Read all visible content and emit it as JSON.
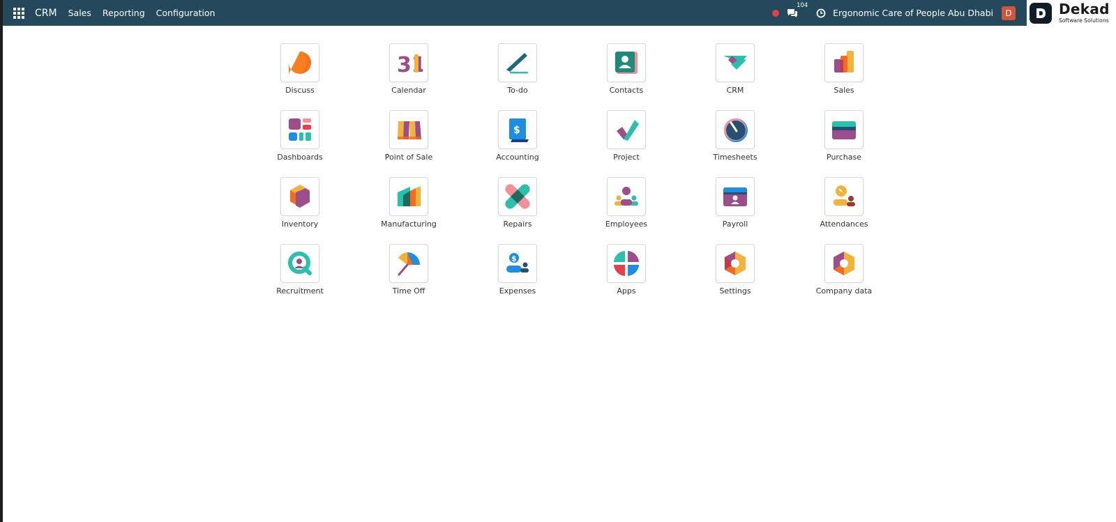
{
  "navbar": {
    "brand": "CRM",
    "menu": [
      "Sales",
      "Reporting",
      "Configuration"
    ],
    "chat_count": "104",
    "company": "Ergonomic Care of People Abu Dhabi",
    "avatar_letter": "D"
  },
  "logo": {
    "name": "Dekad",
    "subtitle": "Software Solutions"
  },
  "apps": [
    {
      "label": "Discuss",
      "icon": "discuss-icon"
    },
    {
      "label": "Calendar",
      "icon": "calendar-icon"
    },
    {
      "label": "To-do",
      "icon": "todo-icon"
    },
    {
      "label": "Contacts",
      "icon": "contacts-icon"
    },
    {
      "label": "CRM",
      "icon": "crm-icon"
    },
    {
      "label": "Sales",
      "icon": "sales-icon"
    },
    {
      "label": "Dashboards",
      "icon": "dashboards-icon"
    },
    {
      "label": "Point of Sale",
      "icon": "point-of-sale-icon"
    },
    {
      "label": "Accounting",
      "icon": "accounting-icon"
    },
    {
      "label": "Project",
      "icon": "project-icon"
    },
    {
      "label": "Timesheets",
      "icon": "timesheets-icon"
    },
    {
      "label": "Purchase",
      "icon": "purchase-icon"
    },
    {
      "label": "Inventory",
      "icon": "inventory-icon"
    },
    {
      "label": "Manufacturing",
      "icon": "manufacturing-icon"
    },
    {
      "label": "Repairs",
      "icon": "repairs-icon"
    },
    {
      "label": "Employees",
      "icon": "employees-icon"
    },
    {
      "label": "Payroll",
      "icon": "payroll-icon"
    },
    {
      "label": "Attendances",
      "icon": "attendances-icon"
    },
    {
      "label": "Recruitment",
      "icon": "recruitment-icon"
    },
    {
      "label": "Time Off",
      "icon": "time-off-icon"
    },
    {
      "label": "Expenses",
      "icon": "expenses-icon"
    },
    {
      "label": "Apps",
      "icon": "apps-icon"
    },
    {
      "label": "Settings",
      "icon": "settings-icon"
    },
    {
      "label": "Company data",
      "icon": "company-data-icon"
    }
  ],
  "calendar_icon_text": "31",
  "colors": {
    "navbar": "#24485c",
    "avatar": "#d2553a",
    "record_dot": "#e2404b"
  }
}
